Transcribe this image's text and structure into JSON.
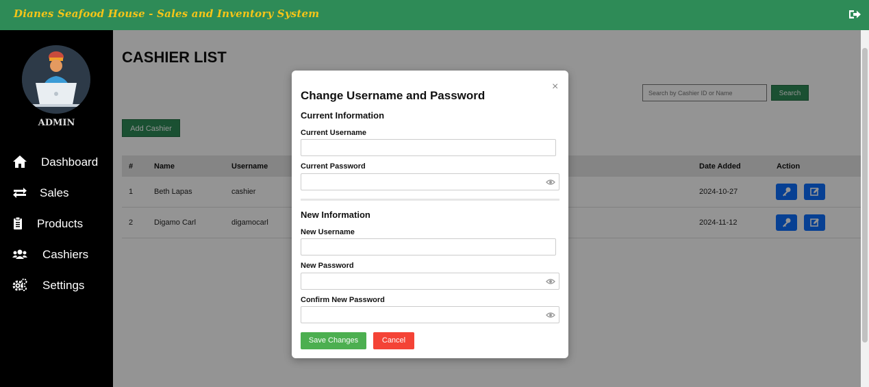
{
  "app": {
    "title": "Dianes Seafood House - Sales and Inventory System",
    "accent_color": "#2e8b57",
    "title_color": "#f5c518"
  },
  "header": {
    "logout_icon": "sign-out-icon"
  },
  "sidebar": {
    "role_label": "ADMIN",
    "items": [
      {
        "label": "Dashboard",
        "icon": "home-icon"
      },
      {
        "label": "Sales",
        "icon": "exchange-icon"
      },
      {
        "label": "Products",
        "icon": "clipboard-icon"
      },
      {
        "label": "Cashiers",
        "icon": "users-icon"
      },
      {
        "label": "Settings",
        "icon": "gears-icon"
      }
    ]
  },
  "main": {
    "page_title": "CASHIER LIST",
    "search_placeholder": "Search by Cashier ID or Name",
    "search_label": "Search",
    "add_label": "Add Cashier",
    "table": {
      "headers": {
        "num": "#",
        "name": "Name",
        "username": "Username",
        "date": "Date Added",
        "action": "Action"
      },
      "rows": [
        {
          "num": "1",
          "name": "Beth Lapas",
          "username": "cashier",
          "date": "2024-10-27"
        },
        {
          "num": "2",
          "name": "Digamo Carl",
          "username": "digamocarl",
          "date": "2024-11-12"
        }
      ],
      "action_icons": [
        "key-icon",
        "edit-icon"
      ],
      "action_color": "#0d6efd"
    }
  },
  "modal": {
    "title": "Change Username and Password",
    "close": "×",
    "current_section": "Current Information",
    "current_username_label": "Current Username",
    "current_password_label": "Current Password",
    "new_section": "New Information",
    "new_username_label": "New Username",
    "new_password_label": "New Password",
    "confirm_password_label": "Confirm New Password",
    "current_username_value": "",
    "current_password_value": "",
    "new_username_value": "",
    "new_password_value": "",
    "confirm_password_value": "",
    "save_label": "Save Changes",
    "cancel_label": "Cancel",
    "save_color": "#4caf50",
    "cancel_color": "#f44336"
  }
}
